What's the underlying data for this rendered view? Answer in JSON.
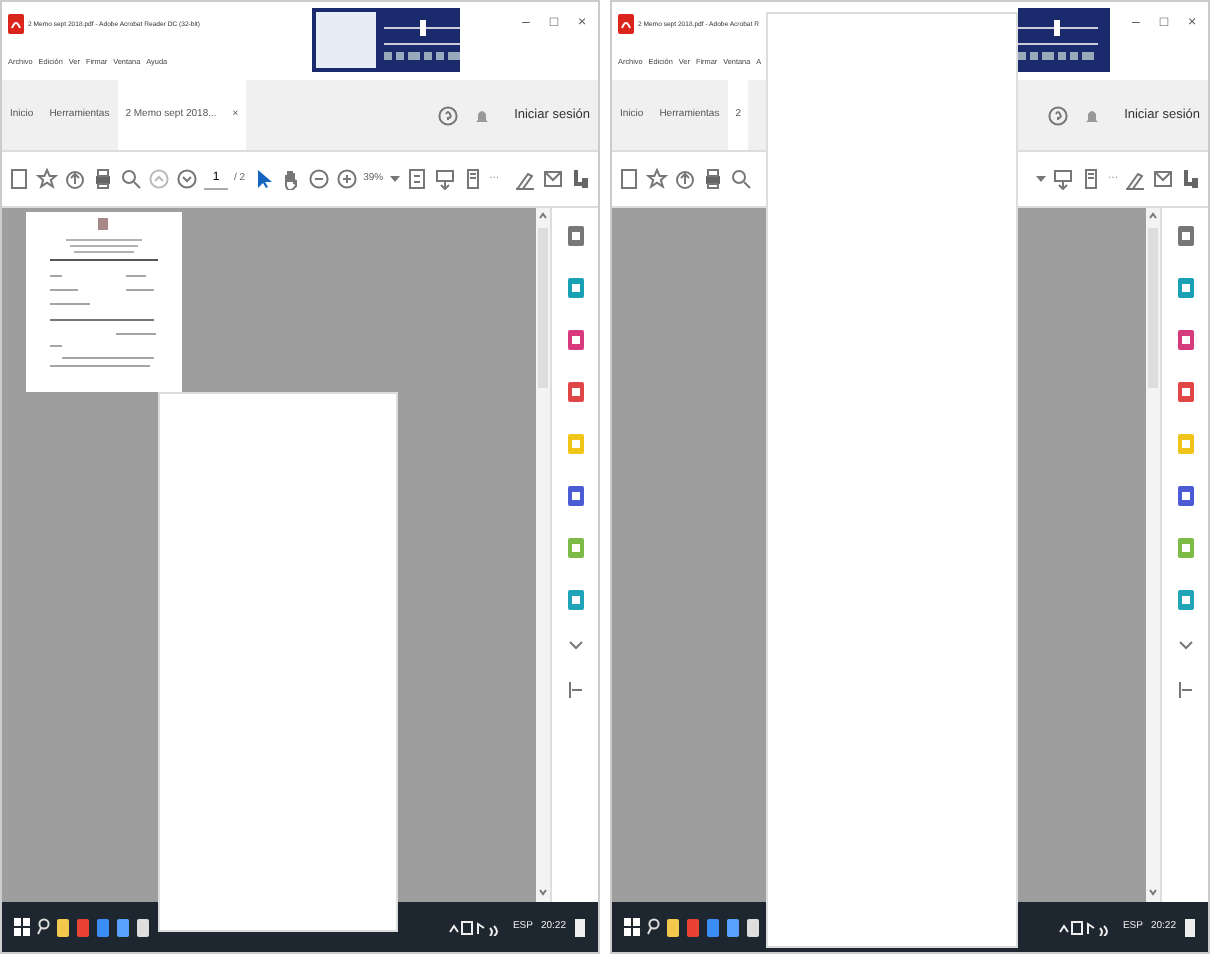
{
  "windows": [
    {
      "title": "2 Memo sept 2018.pdf - Adobe Acrobat Reader DC (32-bit)",
      "controls": [
        "–",
        "□",
        "×"
      ],
      "menu": [
        "Archivo",
        "Edición",
        "Ver",
        "Firmar",
        "Ventana",
        "Ayuda"
      ],
      "tabs": [
        {
          "label": "Inicio",
          "selected": false
        },
        {
          "label": "Herramientas",
          "selected": false
        },
        {
          "label": "2 Memo sept 2018...",
          "selected": true,
          "close": "×"
        }
      ],
      "sign_in": "Iniciar sesión",
      "page_number": "1",
      "page_total": "/ 2",
      "zoom": "39%",
      "more": "···",
      "kind": "page-covered",
      "taskbar": {
        "language": "ESP",
        "time": "20:22"
      }
    },
    {
      "title": "2 Memo sept 2018.pdf - Adobe Acrobat R",
      "controls": [
        "–",
        "□",
        "×"
      ],
      "menu": [
        "Archivo",
        "Edición",
        "Ver",
        "Firmar",
        "Ventana",
        "A"
      ],
      "tabs": [
        {
          "label": "Inicio",
          "selected": false
        },
        {
          "label": "Herramientas",
          "selected": false
        },
        {
          "label": "2",
          "selected": true
        }
      ],
      "sign_in": "Iniciar sesión",
      "more": "···",
      "kind": "window-covered",
      "taskbar": {
        "language": "ESP",
        "time": "20:22"
      }
    }
  ]
}
